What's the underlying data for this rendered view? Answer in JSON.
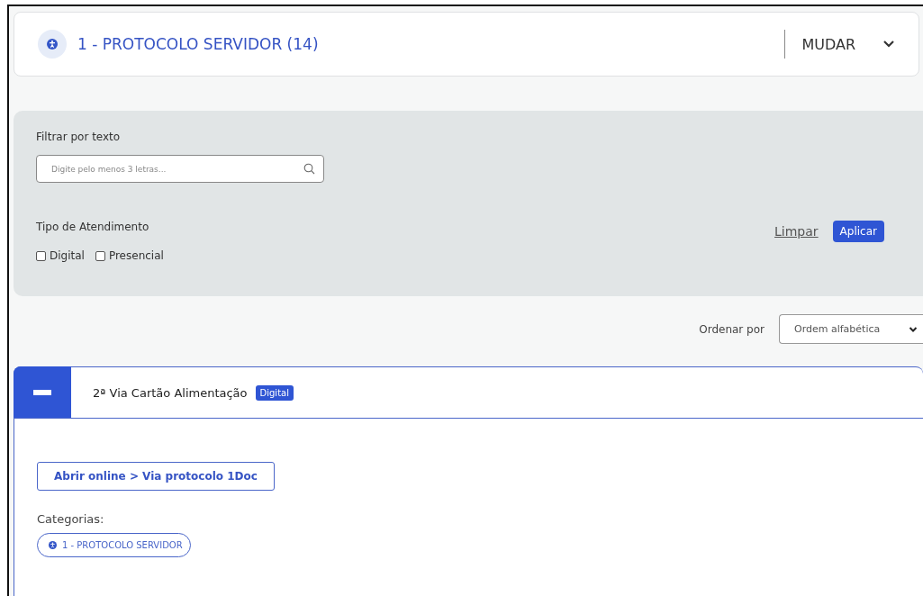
{
  "header": {
    "title": "1 - PROTOCOLO SERVIDOR (14)",
    "change_label": "MUDAR"
  },
  "filter": {
    "text_label": "Filtrar por texto",
    "search": {
      "placeholder": "Digite pelo menos 3 letras..."
    },
    "type_label": "Tipo de Atendimento",
    "options": [
      {
        "label": "Digital",
        "checked": false
      },
      {
        "label": "Presencial",
        "checked": false
      }
    ],
    "clear_label": "Limpar",
    "apply_label": "Aplicar"
  },
  "sort": {
    "label": "Ordenar por",
    "value": "Ordem alfabética"
  },
  "services": [
    {
      "title": "2ª Via Cartão Alimentação",
      "tag": "Digital",
      "expanded": true,
      "action": "Abrir online > Via protocolo 1Doc",
      "categories_label": "Categorias:",
      "categories": [
        "1 - PROTOCOLO SERVIDOR"
      ]
    }
  ]
}
